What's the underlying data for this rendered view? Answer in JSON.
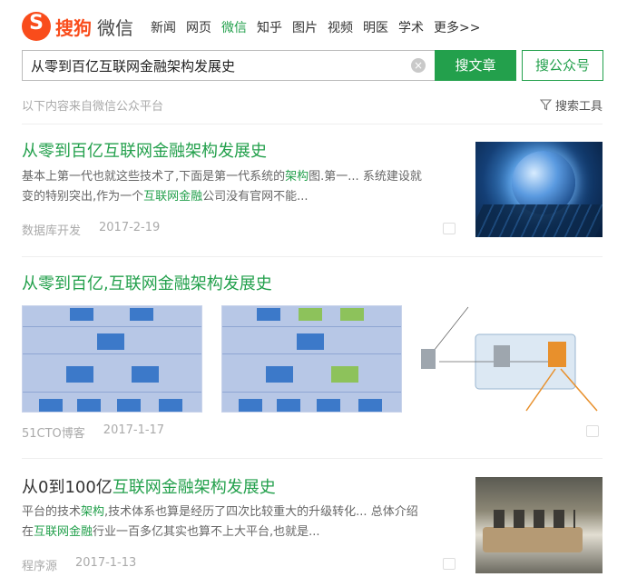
{
  "header": {
    "brand": "搜狗",
    "product": "微信",
    "nav": [
      {
        "label": "新闻",
        "active": false
      },
      {
        "label": "网页",
        "active": false
      },
      {
        "label": "微信",
        "active": true
      },
      {
        "label": "知乎",
        "active": false
      },
      {
        "label": "图片",
        "active": false
      },
      {
        "label": "视频",
        "active": false
      },
      {
        "label": "明医",
        "active": false
      },
      {
        "label": "学术",
        "active": false
      },
      {
        "label": "更多>>",
        "active": false
      }
    ],
    "search_value": "从零到百亿互联网金融架构发展史",
    "clear_icon": "×",
    "btn_article": "搜文章",
    "btn_account": "搜公众号",
    "source_note": "以下内容来自微信公众平台",
    "tools_label": "搜索工具"
  },
  "results": [
    {
      "title": "从零到百亿互联网金融架构发展史",
      "snippet_line1_a": "基本上第一代也就这些技术了,下面是第一代系统的",
      "snippet_line1_em": "架构",
      "snippet_line1_b": "图.第一... 系统建设就",
      "snippet_line2_a": "变的特别突出,作为一个",
      "snippet_line2_em": "互联网金融",
      "snippet_line2_b": "公司没有官网不能...",
      "source": "数据库开发",
      "date": "2017-2-19"
    },
    {
      "title": "从零到百亿,互联网金融架构发展史",
      "source": "51CTO博客",
      "date": "2017-1-17"
    },
    {
      "title_plain": "从0到100亿",
      "title_hl": "互联网金融架构发展史",
      "snippet_line1_a": "平台的技术",
      "snippet_line1_em": "架构",
      "snippet_line1_b": ",技术体系也算是经历了四次比较重大的升级转化... 总体介绍",
      "snippet_line2_a": "在",
      "snippet_line2_em": "互联网金融",
      "snippet_line2_b": "行业一百多亿其实也算不上大平台,也就是...",
      "source": "程序源",
      "date": "2017-1-13"
    }
  ],
  "colors": {
    "accent": "#23a04c",
    "brand": "#f94c1b"
  }
}
